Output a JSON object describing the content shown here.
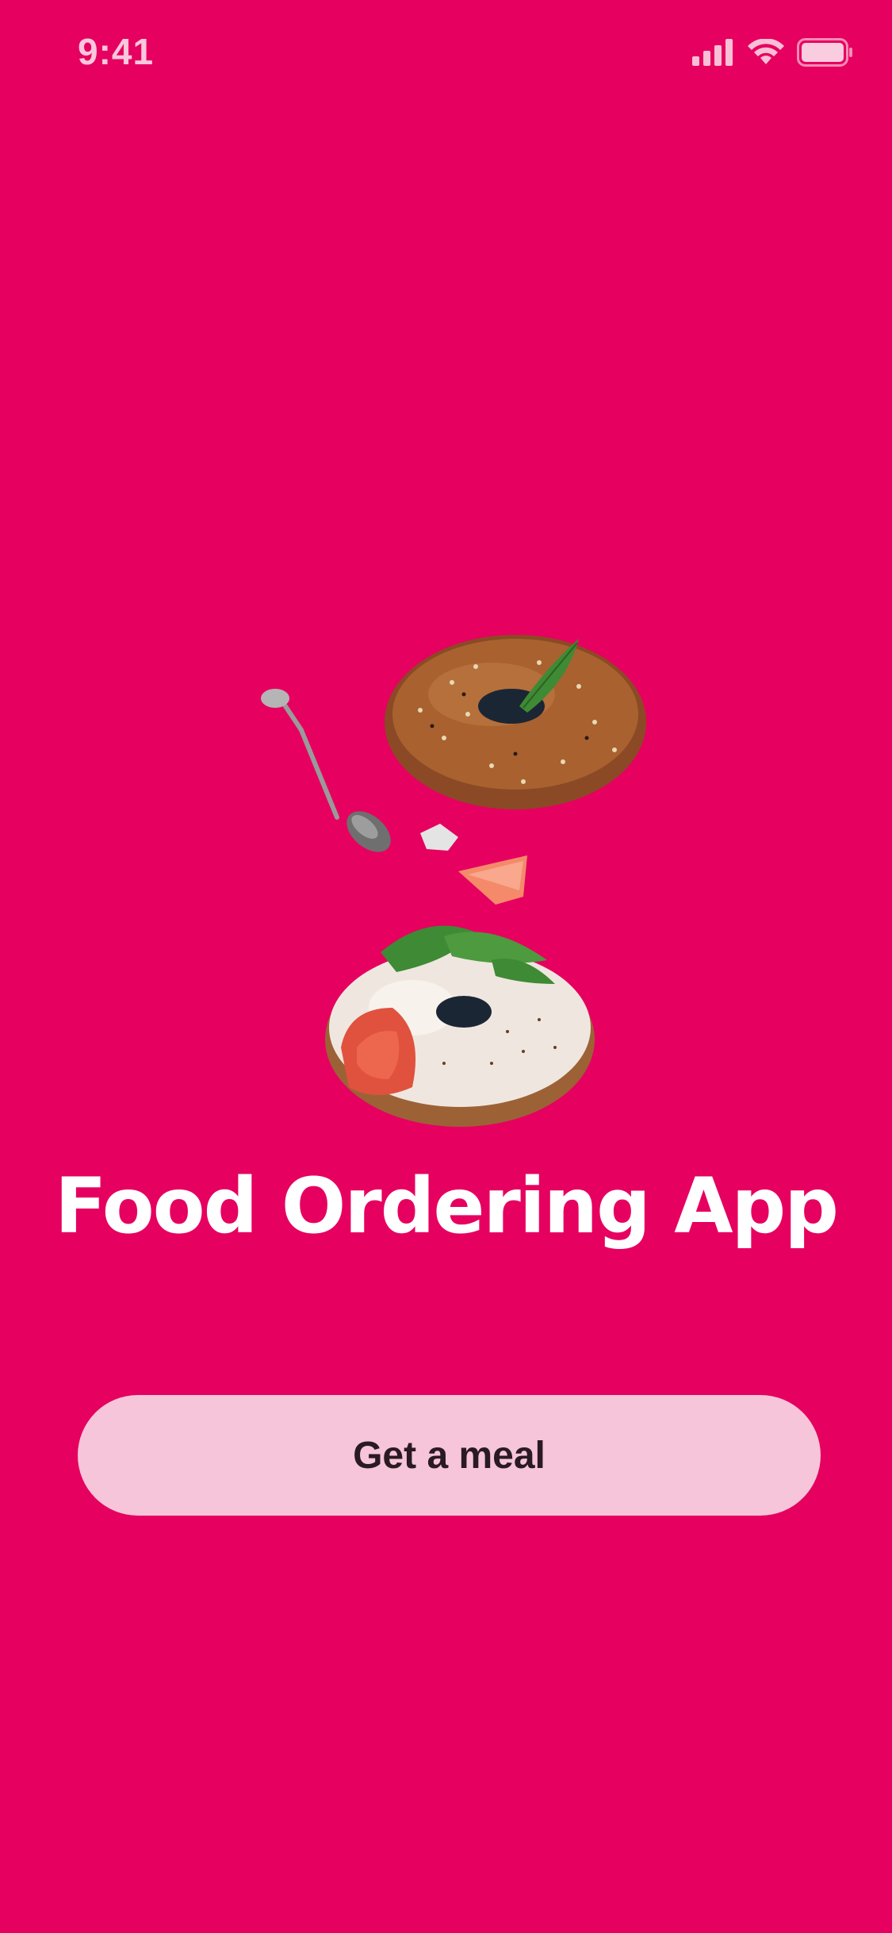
{
  "status_bar": {
    "time": "9:41",
    "icons": [
      "cellular-signal-icon",
      "wifi-icon",
      "battery-icon"
    ]
  },
  "hero": {
    "image": "bagel-illustration"
  },
  "title": "Food Ordering App",
  "cta": {
    "label": "Get a meal"
  },
  "colors": {
    "background": "#E6005F",
    "button_background": "#F6C5DA",
    "button_text": "#2A1A22",
    "title_text": "#FFFFFF"
  }
}
